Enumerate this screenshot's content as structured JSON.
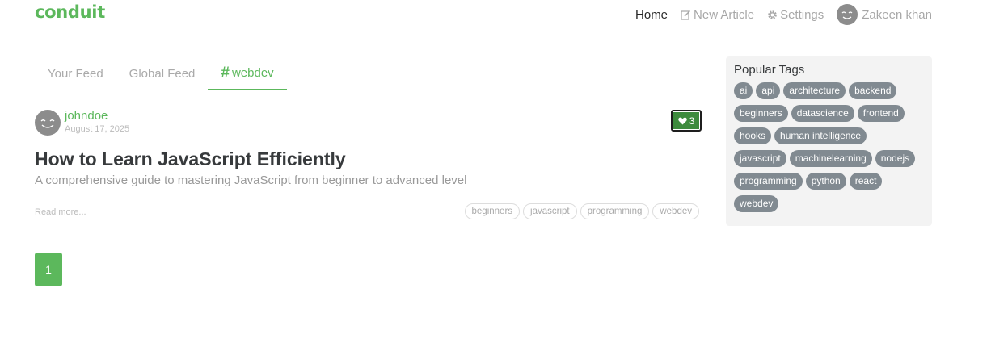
{
  "navbar": {
    "brand": "conduit",
    "links": {
      "home": "Home",
      "new_article": "New Article",
      "settings": "Settings",
      "user": "Zakeen khan"
    }
  },
  "feed": {
    "tabs": [
      "Your Feed",
      "Global Feed",
      "webdev"
    ],
    "active_tab": "webdev"
  },
  "article": {
    "author": "johndoe",
    "date": "August 17, 2025",
    "favorites": "3",
    "title": "How to Learn JavaScript Efficiently",
    "description": "A comprehensive guide to mastering JavaScript from beginner to advanced level",
    "read_more": "Read more...",
    "tags": [
      "beginners",
      "javascript",
      "programming",
      "webdev"
    ]
  },
  "pagination": {
    "pages": [
      "1"
    ],
    "current": "1"
  },
  "sidebar": {
    "title": "Popular Tags",
    "tags": [
      "ai",
      "api",
      "architecture",
      "backend",
      "beginners",
      "datascience",
      "frontend",
      "hooks",
      "human intelligence",
      "javascript",
      "machinelearning",
      "nodejs",
      "programming",
      "python",
      "react",
      "webdev"
    ]
  },
  "colors": {
    "brand": "#5cb85c",
    "tag_bg": "#818a91",
    "sidebar_bg": "#f3f3f3"
  }
}
